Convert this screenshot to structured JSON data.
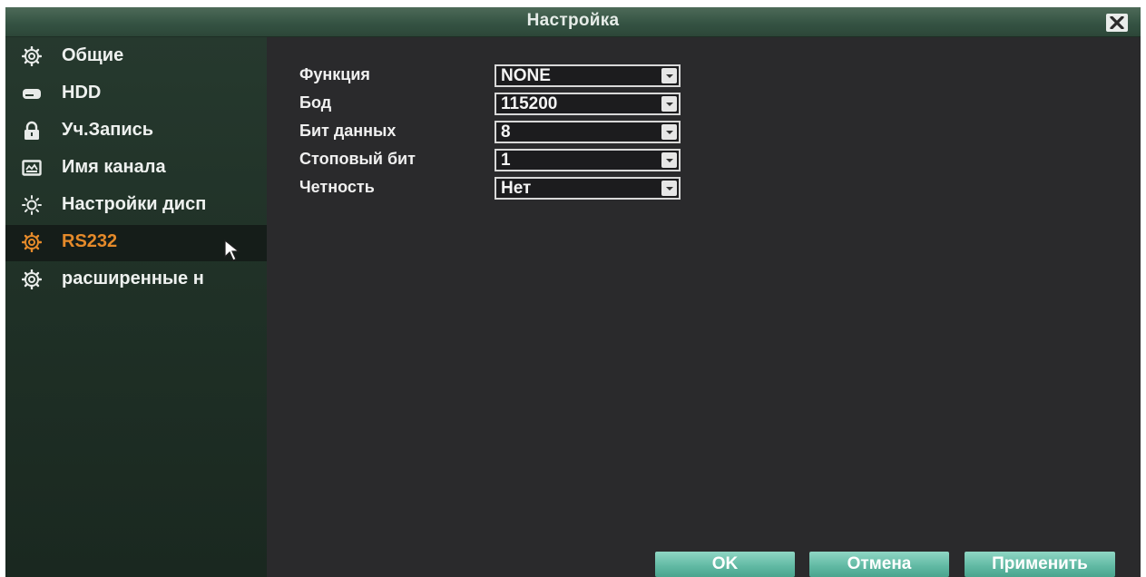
{
  "window": {
    "title": "Настройка"
  },
  "sidebar": {
    "items": [
      {
        "label": "Общие",
        "icon": "gear-icon"
      },
      {
        "label": "HDD",
        "icon": "hdd-icon"
      },
      {
        "label": "Уч.Запись",
        "icon": "lock-icon"
      },
      {
        "label": "Имя канала",
        "icon": "display-icon"
      },
      {
        "label": "Настройки дисп",
        "icon": "sun-icon"
      },
      {
        "label": "RS232",
        "icon": "gear-icon",
        "active": true
      },
      {
        "label": "расширенные н",
        "icon": "gear-icon"
      }
    ]
  },
  "form": {
    "fields": [
      {
        "label": "Функция",
        "value": "NONE"
      },
      {
        "label": "Бод",
        "value": "115200"
      },
      {
        "label": "Бит данных",
        "value": "8"
      },
      {
        "label": "Стоповый бит",
        "value": "1"
      },
      {
        "label": "Четность",
        "value": "Нет"
      }
    ]
  },
  "buttons": {
    "ok": "OK",
    "cancel": "Отмена",
    "apply": "Применить"
  },
  "colors": {
    "active_item": "#e58a2a",
    "button": "#5fb8a2"
  }
}
